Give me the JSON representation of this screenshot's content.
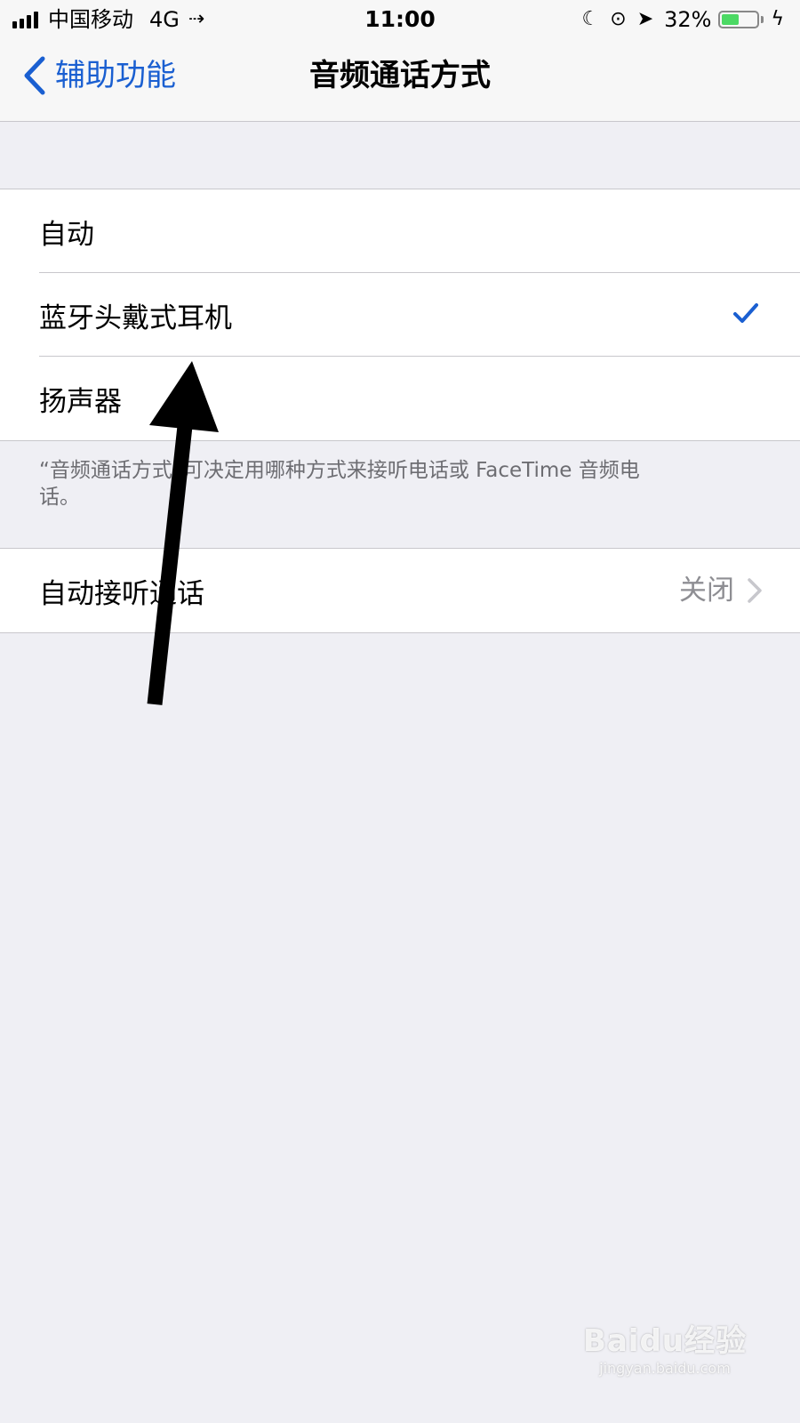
{
  "status_bar": {
    "carrier": "中国移动",
    "network": "4G",
    "time": "11:00",
    "battery_percent_label": "32%",
    "battery_level": 0.32,
    "icons": [
      "signal-icon",
      "call-forward-icon",
      "moon-icon",
      "rotation-lock-icon",
      "location-icon",
      "battery-icon",
      "charging-icon"
    ]
  },
  "nav": {
    "back_label": "辅助功能",
    "title": "音频通话方式"
  },
  "options": {
    "items": [
      {
        "label": "自动",
        "selected": false
      },
      {
        "label": "蓝牙头戴式耳机",
        "selected": true
      },
      {
        "label": "扬声器",
        "selected": false
      }
    ],
    "footer": "“音频通话方式”可决定用哪种方式来接听电话或 FaceTime 音频电话。"
  },
  "auto_answer": {
    "label": "自动接听通话",
    "value": "关闭"
  },
  "watermark": {
    "logo": "Baidu经验",
    "sub": "jingyan.baidu.com"
  },
  "colors": {
    "accent": "#1a5fd1",
    "background": "#efeff4",
    "battery": "#4cd964"
  }
}
